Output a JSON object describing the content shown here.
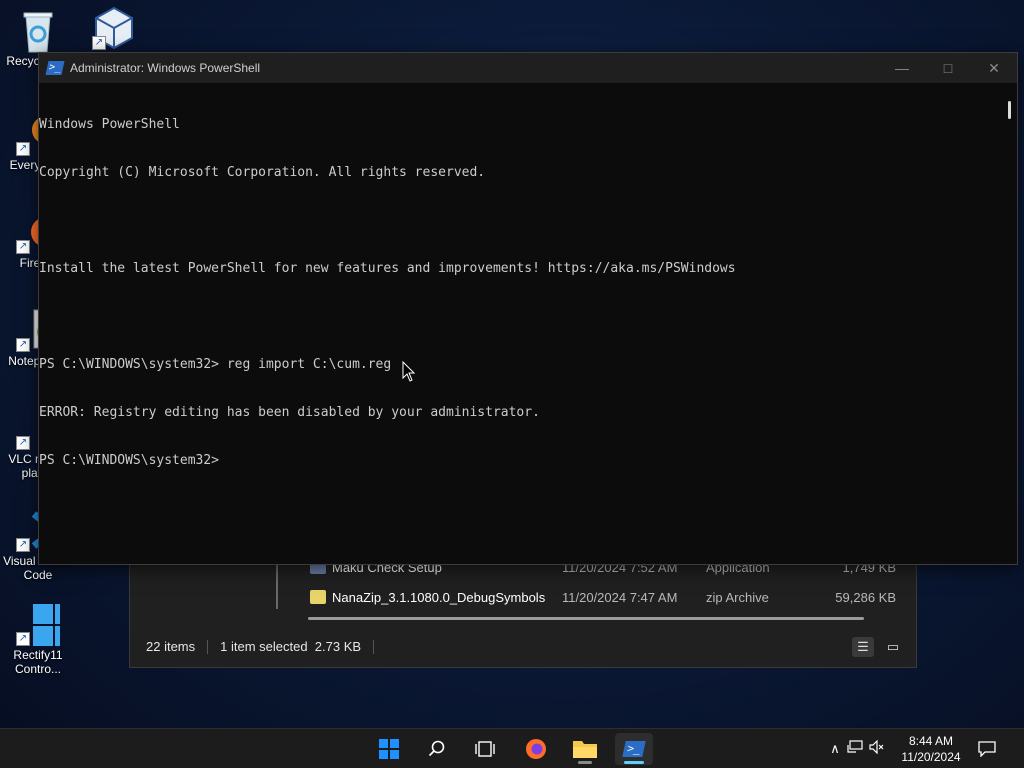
{
  "desktop": {
    "icons": [
      {
        "label": "Recycle Bin"
      },
      {
        "label": "Everything"
      },
      {
        "label": "Firefox"
      },
      {
        "label": "Notepad++"
      },
      {
        "label": "VLC media player"
      },
      {
        "label": "Visual Studio Code"
      },
      {
        "label": "Rectify11 Contro..."
      },
      {
        "label": "Oracle VirtualBox"
      }
    ]
  },
  "explorer": {
    "rows": [
      {
        "name": "Maku Check Setup",
        "date": "11/20/2024 7:52 AM",
        "type": "Application",
        "size": "1,749 KB"
      },
      {
        "name": "NanaZip_3.1.1080.0_DebugSymbols",
        "date": "11/20/2024 7:47 AM",
        "type": "zip Archive",
        "size": "59,286 KB"
      }
    ],
    "status": {
      "items": "22 items",
      "selected": "1 item selected  2.73 KB"
    }
  },
  "powershell": {
    "title": "Administrator: Windows PowerShell",
    "lines": [
      "Windows PowerShell",
      "Copyright (C) Microsoft Corporation. All rights reserved.",
      "",
      "Install the latest PowerShell for new features and improvements! https://aka.ms/PSWindows",
      "",
      "PS C:\\WINDOWS\\system32> reg import C:\\cum.reg",
      "ERROR: Registry editing has been disabled by your administrator.",
      "PS C:\\WINDOWS\\system32>"
    ]
  },
  "taskbar": {
    "clock_time": "8:44 AM",
    "clock_date": "11/20/2024"
  },
  "colors": {
    "accent": "#60cdff",
    "console_bg": "#0c0c0c",
    "console_text": "#cccccc",
    "windows_blue": "#1e90ff"
  }
}
